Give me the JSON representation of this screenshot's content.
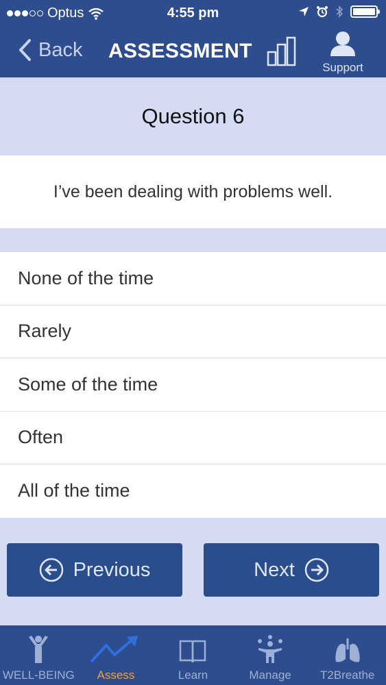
{
  "status_bar": {
    "carrier": "Optus",
    "time": "4:55 pm"
  },
  "nav": {
    "back_label": "Back",
    "title": "ASSESSMENT",
    "support_label": "Support"
  },
  "question": {
    "title": "Question 6",
    "text": "I’ve been dealing with problems well."
  },
  "options": [
    "None of the time",
    "Rarely",
    "Some of the time",
    "Often",
    "All of the time"
  ],
  "buttons": {
    "previous_label": "Previous",
    "next_label": "Next"
  },
  "tabs": [
    {
      "label": "WELL-BEING",
      "icon": "person-arms-up-icon"
    },
    {
      "label": "Assess",
      "icon": "trend-arrow-icon"
    },
    {
      "label": "Learn",
      "icon": "book-icon"
    },
    {
      "label": "Manage",
      "icon": "juggler-icon"
    },
    {
      "label": "T2Breathe",
      "icon": "lungs-icon"
    }
  ],
  "colors": {
    "header_bg": "#2d4d8f",
    "band_bg": "#d4dbf2",
    "button_bg": "#2a4d8d",
    "active_tab": "#f0a13a",
    "inactive_tab": "#9fb0d6"
  }
}
